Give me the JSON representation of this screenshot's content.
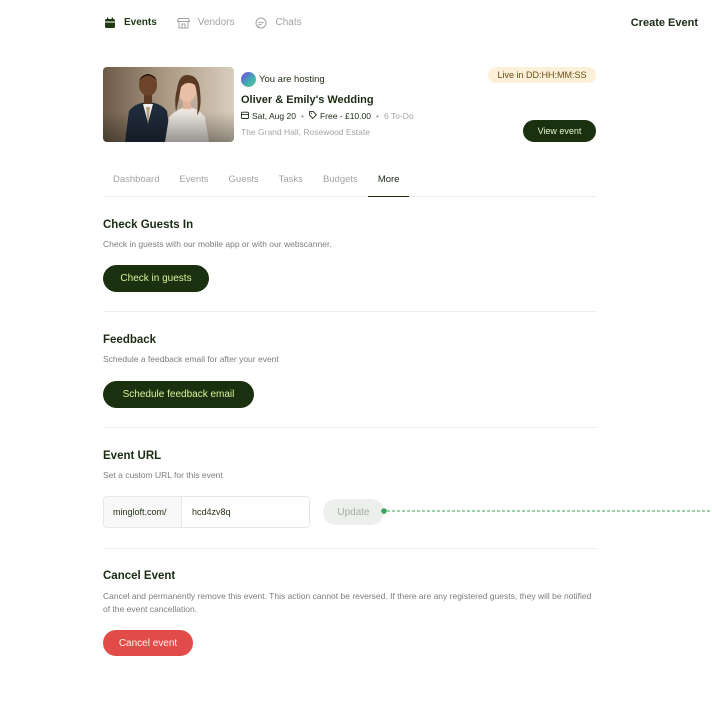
{
  "nav": {
    "items": [
      {
        "label": "Events",
        "icon": "calendar-icon",
        "active": true
      },
      {
        "label": "Vendors",
        "icon": "store-icon",
        "active": false
      },
      {
        "label": "Chats",
        "icon": "chat-icon",
        "active": false
      }
    ],
    "create_event": "Create Event"
  },
  "event": {
    "hosting_label": "You are hosting",
    "title": "Oliver & Emily's Wedding",
    "date": "Sat, Aug 20",
    "price": "Free - £10.00",
    "todo": "6 To-Do",
    "venue": "The Grand Hall, Rosewood Estate",
    "live_badge": "Live in DD:HH:MM:SS",
    "view_button": "View event"
  },
  "tabs": [
    {
      "label": "Dashboard",
      "active": false
    },
    {
      "label": "Events",
      "active": false
    },
    {
      "label": "Guests",
      "active": false
    },
    {
      "label": "Tasks",
      "active": false
    },
    {
      "label": "Budgets",
      "active": false
    },
    {
      "label": "More",
      "active": true
    }
  ],
  "checkin": {
    "title": "Check Guests In",
    "desc": "Check in guests with our mobile app or with our webscanner.",
    "button": "Check in guests"
  },
  "feedback": {
    "title": "Feedback",
    "desc": "Schedule a feedback email for after your event",
    "button": "Schedule feedback email"
  },
  "event_url": {
    "title": "Event URL",
    "desc": "Set a custom URL for this event",
    "prefix": "mingloft.com/",
    "value": "hcd4zv8q",
    "update_button": "Update"
  },
  "cancel": {
    "title": "Cancel Event",
    "desc": "Cancel and permanently remove this event. This action cannot be reversed. If there are any registered guests, they will be notified of the event cancellation.",
    "button": "Cancel event"
  },
  "colors": {
    "primary_dark": "#1b300f",
    "primary_text": "#d9f39b",
    "danger": "#e24c48",
    "badge_bg": "#fcf0d9",
    "connector": "#3aa35a"
  }
}
